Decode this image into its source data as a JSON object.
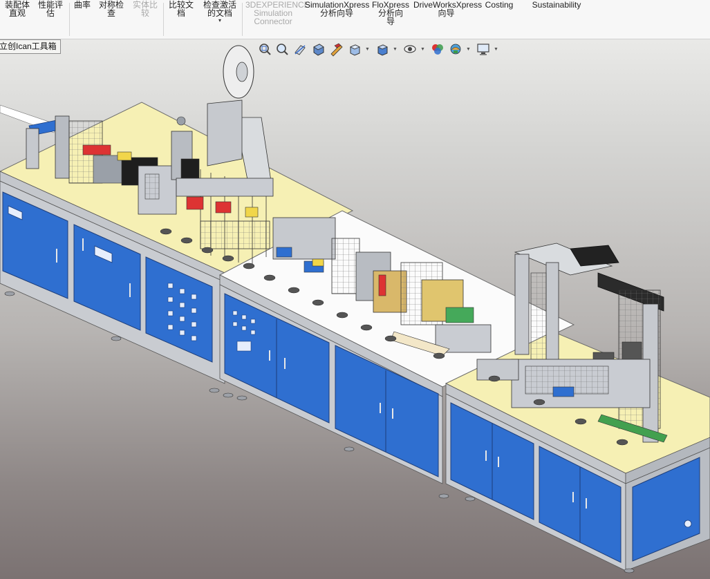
{
  "ribbon": {
    "items": [
      {
        "id": "assembly-visualization",
        "lines": [
          "装配体",
          "直观"
        ],
        "enabled": true
      },
      {
        "id": "performance-evaluation",
        "lines": [
          "性能评",
          "估"
        ],
        "enabled": true
      },
      {
        "id": "curvature",
        "lines": [
          "曲率"
        ],
        "enabled": true
      },
      {
        "id": "symmetry-check",
        "lines": [
          "对称检",
          "查"
        ],
        "enabled": true
      },
      {
        "id": "compare-geometry",
        "lines": [
          "实体比",
          "较"
        ],
        "enabled": false
      },
      {
        "id": "compare-documents",
        "lines": [
          "比较文",
          "档"
        ],
        "enabled": true
      },
      {
        "id": "check-active-document",
        "lines": [
          "检查激活",
          "的文档"
        ],
        "enabled": true,
        "dropdown": true
      },
      {
        "id": "3dexperience-connector",
        "lines": [
          "3DEXPERIENCE",
          "Simulation",
          "Connector"
        ],
        "enabled": false
      },
      {
        "id": "simulationxpress",
        "lines": [
          "SimulationXpress",
          "分析向导"
        ],
        "enabled": true
      },
      {
        "id": "floxpress",
        "lines": [
          "FloXpress",
          "分析向",
          "导"
        ],
        "enabled": true
      },
      {
        "id": "driveworksxpress",
        "lines": [
          "DriveWorksXpress",
          "向导"
        ],
        "enabled": true
      },
      {
        "id": "costing",
        "lines": [
          "Costing"
        ],
        "enabled": true
      },
      {
        "id": "sustainability",
        "lines": [
          "Sustainability"
        ],
        "enabled": true
      }
    ]
  },
  "toolbox": {
    "label": "立创Ican工具箱"
  },
  "hud": {
    "icons": [
      "zoom-to-fit-icon",
      "zoom-to-area-icon",
      "previous-view-icon",
      "section-view-icon",
      "dynamic-annotation-icon",
      "view-orientation-icon",
      "display-style-icon",
      "hide-show-items-icon",
      "edit-appearance-icon",
      "apply-scene-icon",
      "view-settings-icon"
    ]
  },
  "colors": {
    "cabinet_blue": "#2f6fd0",
    "cabinet_blue_dark": "#1d4f9e",
    "tabletop_yellow": "#f6f0b4",
    "tabletop_white": "#fbfbfb",
    "frame_grey": "#c4c7cc",
    "background_top": "#f2f2f0",
    "background_bottom": "#7b7272"
  }
}
